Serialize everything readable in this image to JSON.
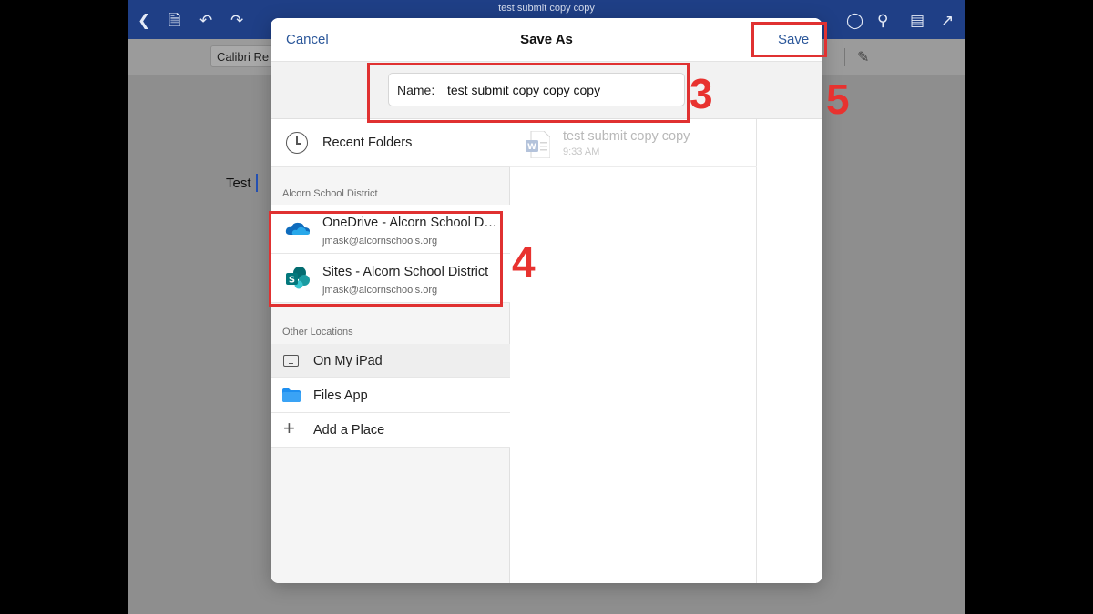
{
  "document": {
    "window_title": "test submit copy copy",
    "font_name": "Calibri Re",
    "body_text": "Test"
  },
  "toolbar_icons": [
    "back-icon",
    "save-doc-icon",
    "undo-icon",
    "redo-icon",
    "lightbulb-icon",
    "search-icon",
    "reader-icon",
    "share-icon"
  ],
  "dialog": {
    "title": "Save As",
    "cancel_label": "Cancel",
    "save_label": "Save",
    "name_label": "Name:",
    "name_value": "test submit copy copy copy"
  },
  "locations": {
    "recent_label": "Recent Folders",
    "account_section": "Alcorn School District",
    "onedrive": {
      "label": "OneDrive - Alcorn School District",
      "account": "jmask@alcornschools.org"
    },
    "sites": {
      "label": "Sites - Alcorn School District",
      "account": "jmask@alcornschools.org"
    },
    "other_section": "Other Locations",
    "ipad_label": "On My iPad",
    "files_label": "Files App",
    "add_place_label": "Add a Place"
  },
  "file_list": [
    {
      "name": "test submit copy copy",
      "time": "9:33 AM"
    }
  ],
  "annotations": [
    "3",
    "4",
    "5"
  ],
  "colors": {
    "word_blue": "#1f3f86",
    "link_blue": "#2b579a",
    "annotation_red": "#e03131"
  }
}
